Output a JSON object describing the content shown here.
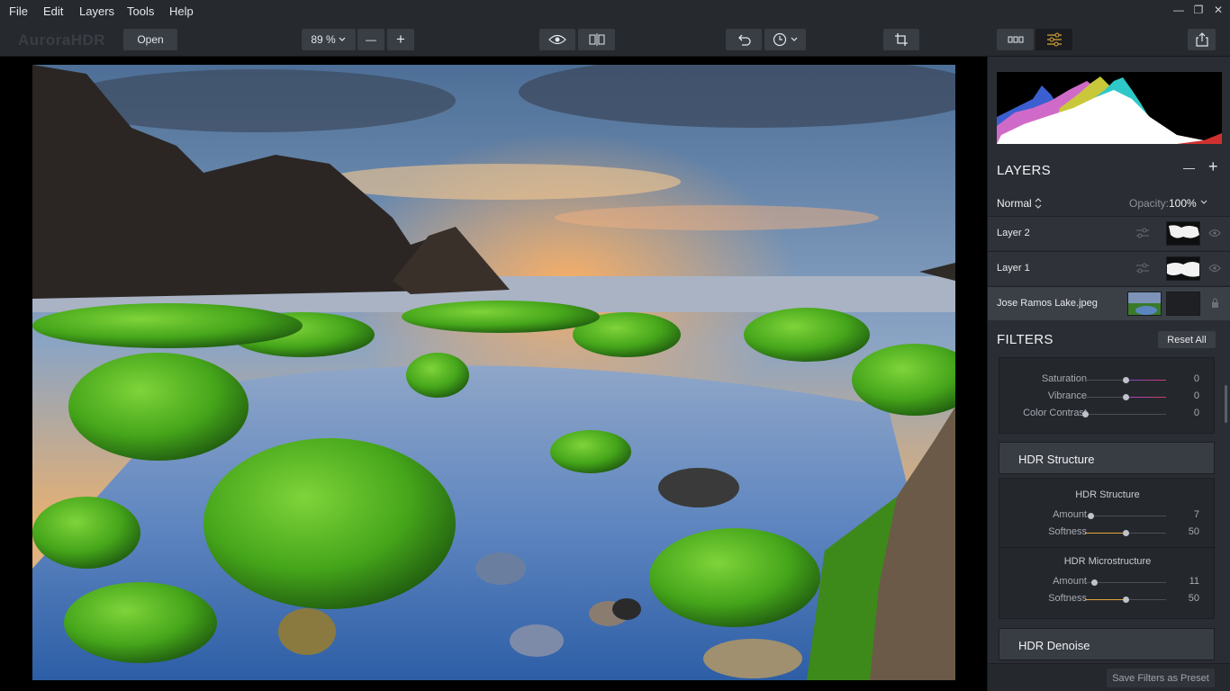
{
  "menu": [
    "File",
    "Edit",
    "Layers",
    "Tools",
    "Help"
  ],
  "window_controls": {
    "minimize": "—",
    "restore": "❐",
    "close": "✕"
  },
  "toolbar": {
    "logo": "AuroraHDR",
    "open_label": "Open",
    "zoom_label": "89 %",
    "zoom_out": "—",
    "zoom_in": "+"
  },
  "panel": {
    "layers_title": "LAYERS",
    "layers_minus": "—",
    "layers_plus": "+",
    "blend_mode": "Normal",
    "opacity_label": "Opacity:",
    "opacity_value": "100%",
    "layers": [
      {
        "name": "Layer 2"
      },
      {
        "name": "Layer 1"
      },
      {
        "name": "Jose Ramos Lake.jpeg"
      }
    ],
    "filters_title": "FILTERS",
    "reset_all": "Reset All",
    "color_sliders": [
      {
        "label": "Saturation",
        "value": "0"
      },
      {
        "label": "Vibrance",
        "value": "0"
      },
      {
        "label": "Color Contrast",
        "value": "0"
      }
    ],
    "hdr_structure": {
      "header": "HDR Structure",
      "group1_title": "HDR Structure",
      "group1": [
        {
          "label": "Amount",
          "value": "7"
        },
        {
          "label": "Softness",
          "value": "50"
        }
      ],
      "group2_title": "HDR Microstructure",
      "group2": [
        {
          "label": "Amount",
          "value": "11"
        },
        {
          "label": "Softness",
          "value": "50"
        }
      ]
    },
    "hdr_denoise_header": "HDR Denoise",
    "save_preset": "Save Filters as Preset"
  },
  "slider_levels": {
    "saturation": 0.5,
    "vibrance": 0.5,
    "color_contrast": 0.0,
    "structure_amount": 0.07,
    "structure_softness": 0.5,
    "micro_amount": 0.11,
    "micro_softness": 0.5
  },
  "colors": {
    "accent": "#e0a93a",
    "panel_bg": "#2a2d33",
    "toolbar_bg": "#26292e",
    "sky_warm": "#f2a35a",
    "moss": "#4fae1e",
    "water": "#3b6fb0"
  }
}
